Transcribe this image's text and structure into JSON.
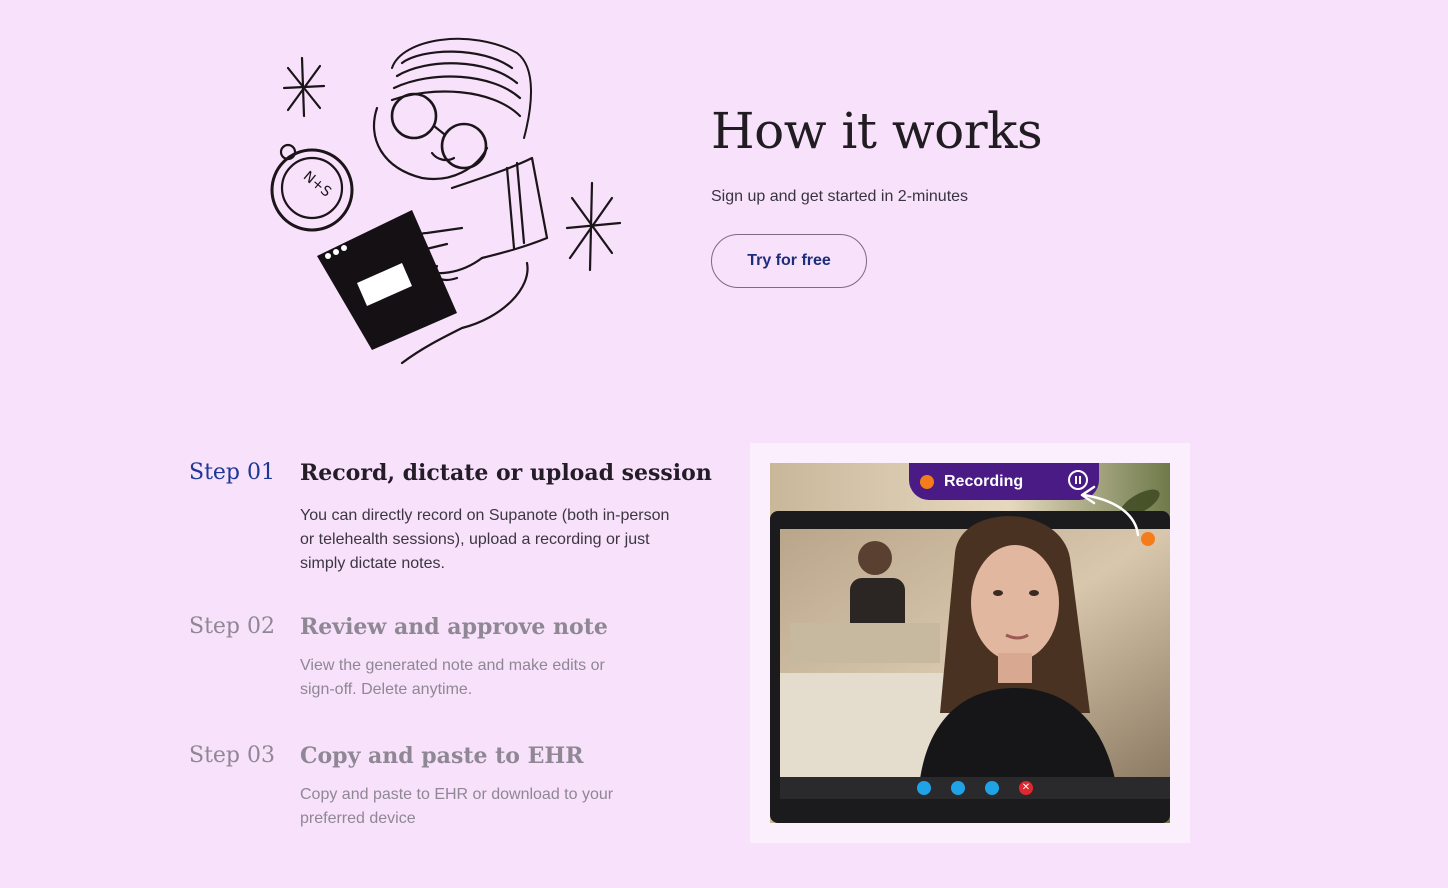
{
  "hero": {
    "title": "How it works",
    "subtitle": "Sign up and get started in 2-minutes",
    "cta_label": "Try for free"
  },
  "steps": [
    {
      "number": "Step 01",
      "title": "Record, dictate or upload session",
      "description": "You can directly record on Supanote (both in-person or telehealth sessions), upload a recording or just simply dictate notes.",
      "active": true
    },
    {
      "number": "Step 02",
      "title": "Review and approve note",
      "description": "View the generated note and make edits or sign-off. Delete anytime.",
      "active": false
    },
    {
      "number": "Step 03",
      "title": "Copy and paste to EHR",
      "description": "Copy and paste to EHR or download to your preferred device",
      "active": false
    }
  ],
  "media": {
    "recording_label": "Recording",
    "call_controls": [
      "video-icon",
      "signal-icon",
      "chat-icon",
      "end-call-icon"
    ]
  },
  "colors": {
    "background": "#f7e1fb",
    "accent_blue": "#1d3795",
    "recording_pill": "#4a1a85",
    "recording_dot": "#f47c1b"
  }
}
